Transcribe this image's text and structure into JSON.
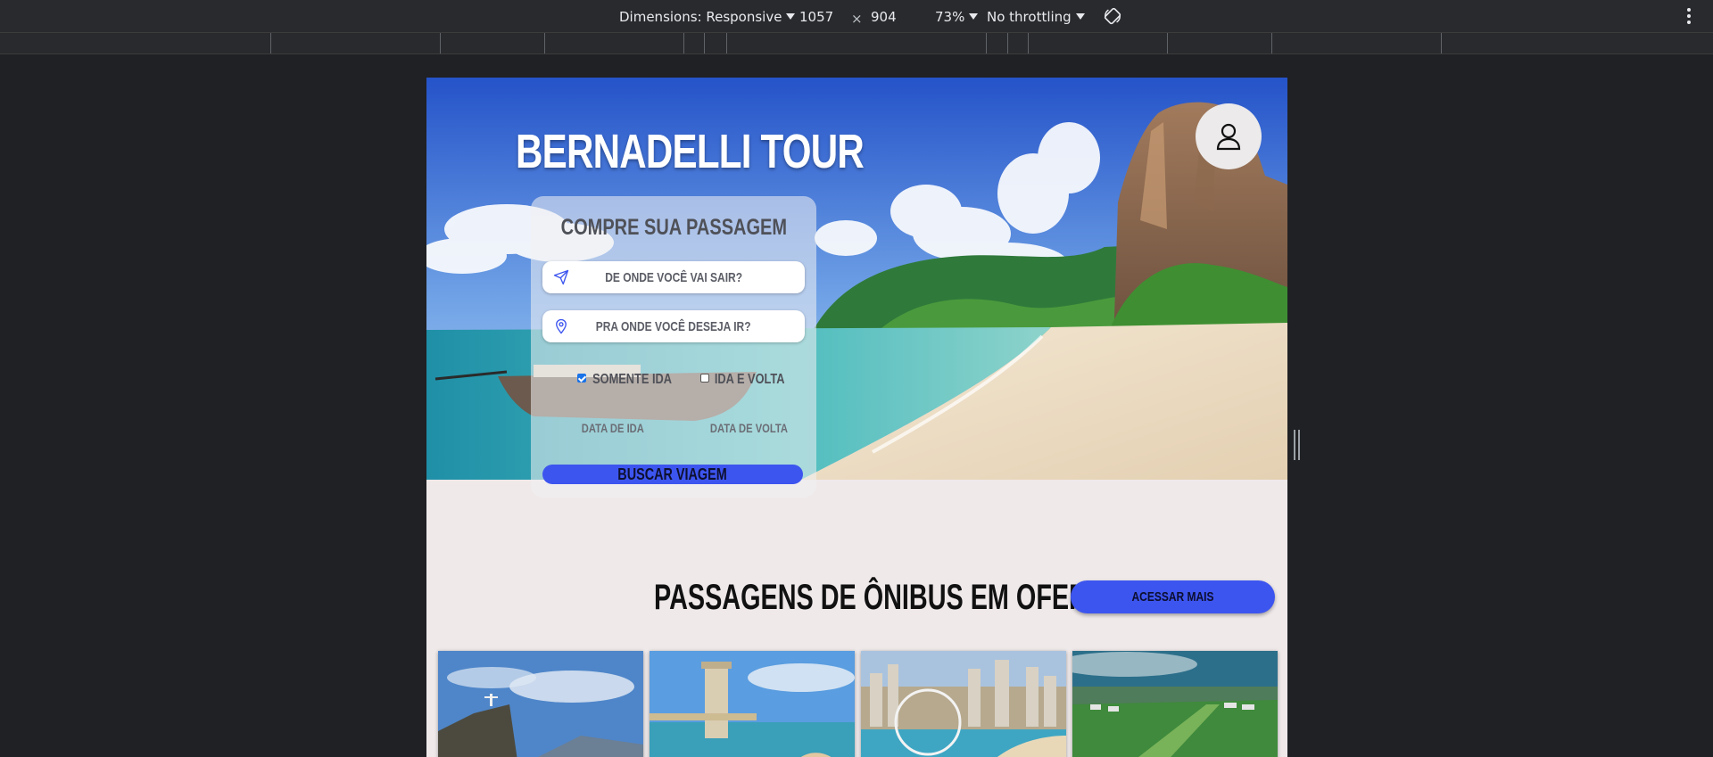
{
  "devtools": {
    "dimensions_label": "Dimensions: Responsive",
    "width": "1057",
    "times": "×",
    "height": "904",
    "zoom": "73%",
    "throttling": "No throttling",
    "rotate_icon": "rotate-device-icon",
    "menu_icon": "more-vertical-icon"
  },
  "page": {
    "brand": "BERNADELLI TOUR",
    "profile_icon": "user-icon",
    "form": {
      "title": "COMPRE SUA PASSAGEM",
      "from_placeholder": "DE ONDE VOCÊ VAI SAIR?",
      "from_icon": "send-icon",
      "to_placeholder": "PRA ONDE VOCÊ DESEJA IR?",
      "to_icon": "map-pin-icon",
      "one_way_label": "SOMENTE IDA",
      "one_way_checked": true,
      "round_trip_label": "IDA E VOLTA",
      "round_trip_checked": false,
      "departure_date_label": "DATA DE IDA",
      "return_date_label": "DATA DE VOLTA",
      "search_button": "BUSCAR VIAGEM"
    },
    "offers": {
      "title": "PASSAGENS DE ÔNIBUS EM OFERTA",
      "more_button": "ACESSAR MAIS"
    },
    "colors": {
      "accent": "#3d55ef",
      "page_background": "#efe9ea"
    }
  }
}
